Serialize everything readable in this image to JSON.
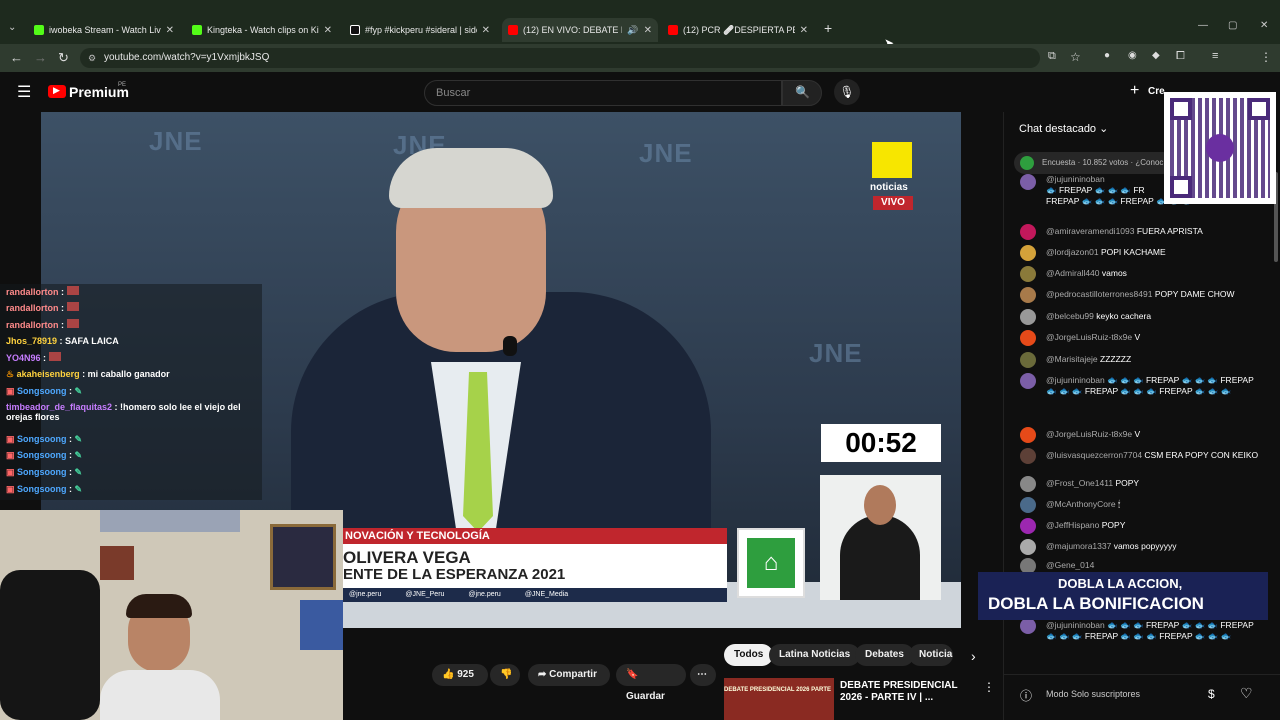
{
  "tabs": [
    {
      "label": "iwobeka Stream - Watch Live o",
      "favicon_color": "#53fc18"
    },
    {
      "label": "Kingteka - Watch clips on Kick",
      "favicon_color": "#53fc18"
    },
    {
      "label": "#fyp #kickperu #sideral | sidera",
      "favicon_color": "#111111"
    },
    {
      "label": "(12) EN VIVO: DEBATE PRES",
      "favicon_color": "#ff0000"
    },
    {
      "label": "(12) PCR 🩹DESPIERTA PERU -",
      "favicon_color": "#ff0000"
    }
  ],
  "url": "youtube.com/watch?v=y1VxmjbkJSQ",
  "youtube": {
    "logo": "Premium",
    "region": "PE",
    "search_placeholder": "Buscar",
    "create_label": "Cre"
  },
  "video": {
    "badge_brand": "noticias",
    "badge_live": "VIVO",
    "timer": "00:52",
    "lower_third_top": "NOVACIÓN Y TECNOLOGÍA",
    "lower_third_name": "OLIVERA VEGA",
    "lower_third_party": "ENTE DE LA ESPERANZA 2021",
    "socials": [
      "@jne.peru",
      "@JNE_Peru",
      "@jne.peru",
      "@JNE_Media"
    ],
    "watermark": "JNE"
  },
  "stream_chat": [
    {
      "user": "randallorton",
      "text": "",
      "color": "#ff6b6b"
    },
    {
      "user": "randallorton",
      "text": "",
      "color": "#ff6b6b"
    },
    {
      "user": "randallorton",
      "text": "",
      "color": "#ff6b6b"
    },
    {
      "user": "Jhos_78919",
      "text": "SAFA LAICA",
      "color": "#ffd23f"
    },
    {
      "user": "YO4N96",
      "text": "",
      "color": "#c77dff"
    },
    {
      "user": "akaheisenberg",
      "text": "mi caballo ganador",
      "color": "#ffd23f"
    },
    {
      "user": "Songsoong",
      "text": "",
      "color": "#4ea8ff"
    },
    {
      "user": "timbeador_de_flaquitas2",
      "text": "!homero solo lee el viejo del orejas flores",
      "color": "#c77dff"
    },
    {
      "user": "Songsoong",
      "text": "",
      "color": "#4ea8ff"
    },
    {
      "user": "Songsoong",
      "text": "",
      "color": "#4ea8ff"
    },
    {
      "user": "Songsoong",
      "text": "",
      "color": "#4ea8ff"
    },
    {
      "user": "Songsoong",
      "text": "",
      "color": "#4ea8ff"
    }
  ],
  "actions": {
    "likes": "925",
    "share": "Compartir",
    "save": "Guardar"
  },
  "chips": [
    "Todos",
    "Latina Noticias",
    "Debates",
    "Noticias"
  ],
  "related": {
    "title": "DEBATE PRESIDENCIAL 2026 - PARTE IV | ...",
    "thumb_label": "DEBATE PRESIDENCIAL 2026 PARTE"
  },
  "live_chat": {
    "header": "Chat destacado",
    "poll": "Encuesta · 10.852 votos · ¿Conoc",
    "mode": "Modo Solo suscriptores",
    "messages": [
      {
        "user": "@jujunininoban",
        "text": "🐟 FREPAP 🐟 🐟 🐟 FR",
        "avatar_color": "#7b5ea7"
      },
      {
        "user": "",
        "text": "FREPAP 🐟 🐟 🐟 FREPAP 🐟 🐟 🐟",
        "avatar_color": ""
      },
      {
        "user": "@amiraveramendi1093",
        "text": "FUERA APRISTA",
        "avatar_color": "#c2185b"
      },
      {
        "user": "@lordjazon01",
        "text": "POPI KACHAME",
        "avatar_color": "#d4a23a"
      },
      {
        "user": "@Admirall440",
        "text": "vamos",
        "avatar_color": "#8a7a3a"
      },
      {
        "user": "@pedrocastilloterrones8491",
        "text": "POPY DAME CHOW",
        "avatar_color": "#a87a4a"
      },
      {
        "user": "@belcebu99",
        "text": "keyko cachera",
        "avatar_color": "#999999"
      },
      {
        "user": "@JorgeLuisRuiz-t8x9e",
        "text": "V",
        "avatar_color": "#e64a19"
      },
      {
        "user": "@Marisitajeje",
        "text": "ZZZZZZ",
        "avatar_color": "#6a6a3a"
      },
      {
        "user": "@jujunininoban",
        "text": "🐟 🐟 🐟 FREPAP 🐟 🐟 🐟 FREPAP 🐟 🐟 🐟 FREPAP 🐟 🐟 🐟 FREPAP 🐟 🐟 🐟",
        "avatar_color": "#7b5ea7"
      },
      {
        "user": "@JorgeLuisRuiz-t8x9e",
        "text": "V",
        "avatar_color": "#e64a19"
      },
      {
        "user": "@luisvasquezcerron7704",
        "text": "CSM ERA POPY CON KEIKO",
        "avatar_color": "#5d4037"
      },
      {
        "user": "@Frost_One1411",
        "text": "POPY",
        "avatar_color": "#888888"
      },
      {
        "user": "@McAnthonyCore",
        "text": "🕯",
        "avatar_color": "#4a6a8a"
      },
      {
        "user": "@JeffHispano",
        "text": "POPY",
        "avatar_color": "#9c27b0"
      },
      {
        "user": "@majumora1337",
        "text": "vamos popyyyyy",
        "avatar_color": "#aaaaaa"
      },
      {
        "user": "@Gene_014",
        "text": "",
        "avatar_color": "#777777"
      },
      {
        "user": "@jujunininoban",
        "text": "🐟 🐟 🐟 FREPAP 🐟 🐟 🐟 FREPAP 🐟 🐟 🐟 FREPAP 🐟 🐟 🐟 FREPAP 🐟 🐟 🐟",
        "avatar_color": "#7b5ea7"
      }
    ]
  },
  "promo": {
    "line1": "DOBLA LA ACCION,",
    "line2": "DOBLA LA BONIFICACION"
  },
  "colors": {
    "accent_green": "#53fc18",
    "yt_red": "#ff0000",
    "jne_bar": "#c0262d",
    "jne_green": "#2e9e3e"
  }
}
